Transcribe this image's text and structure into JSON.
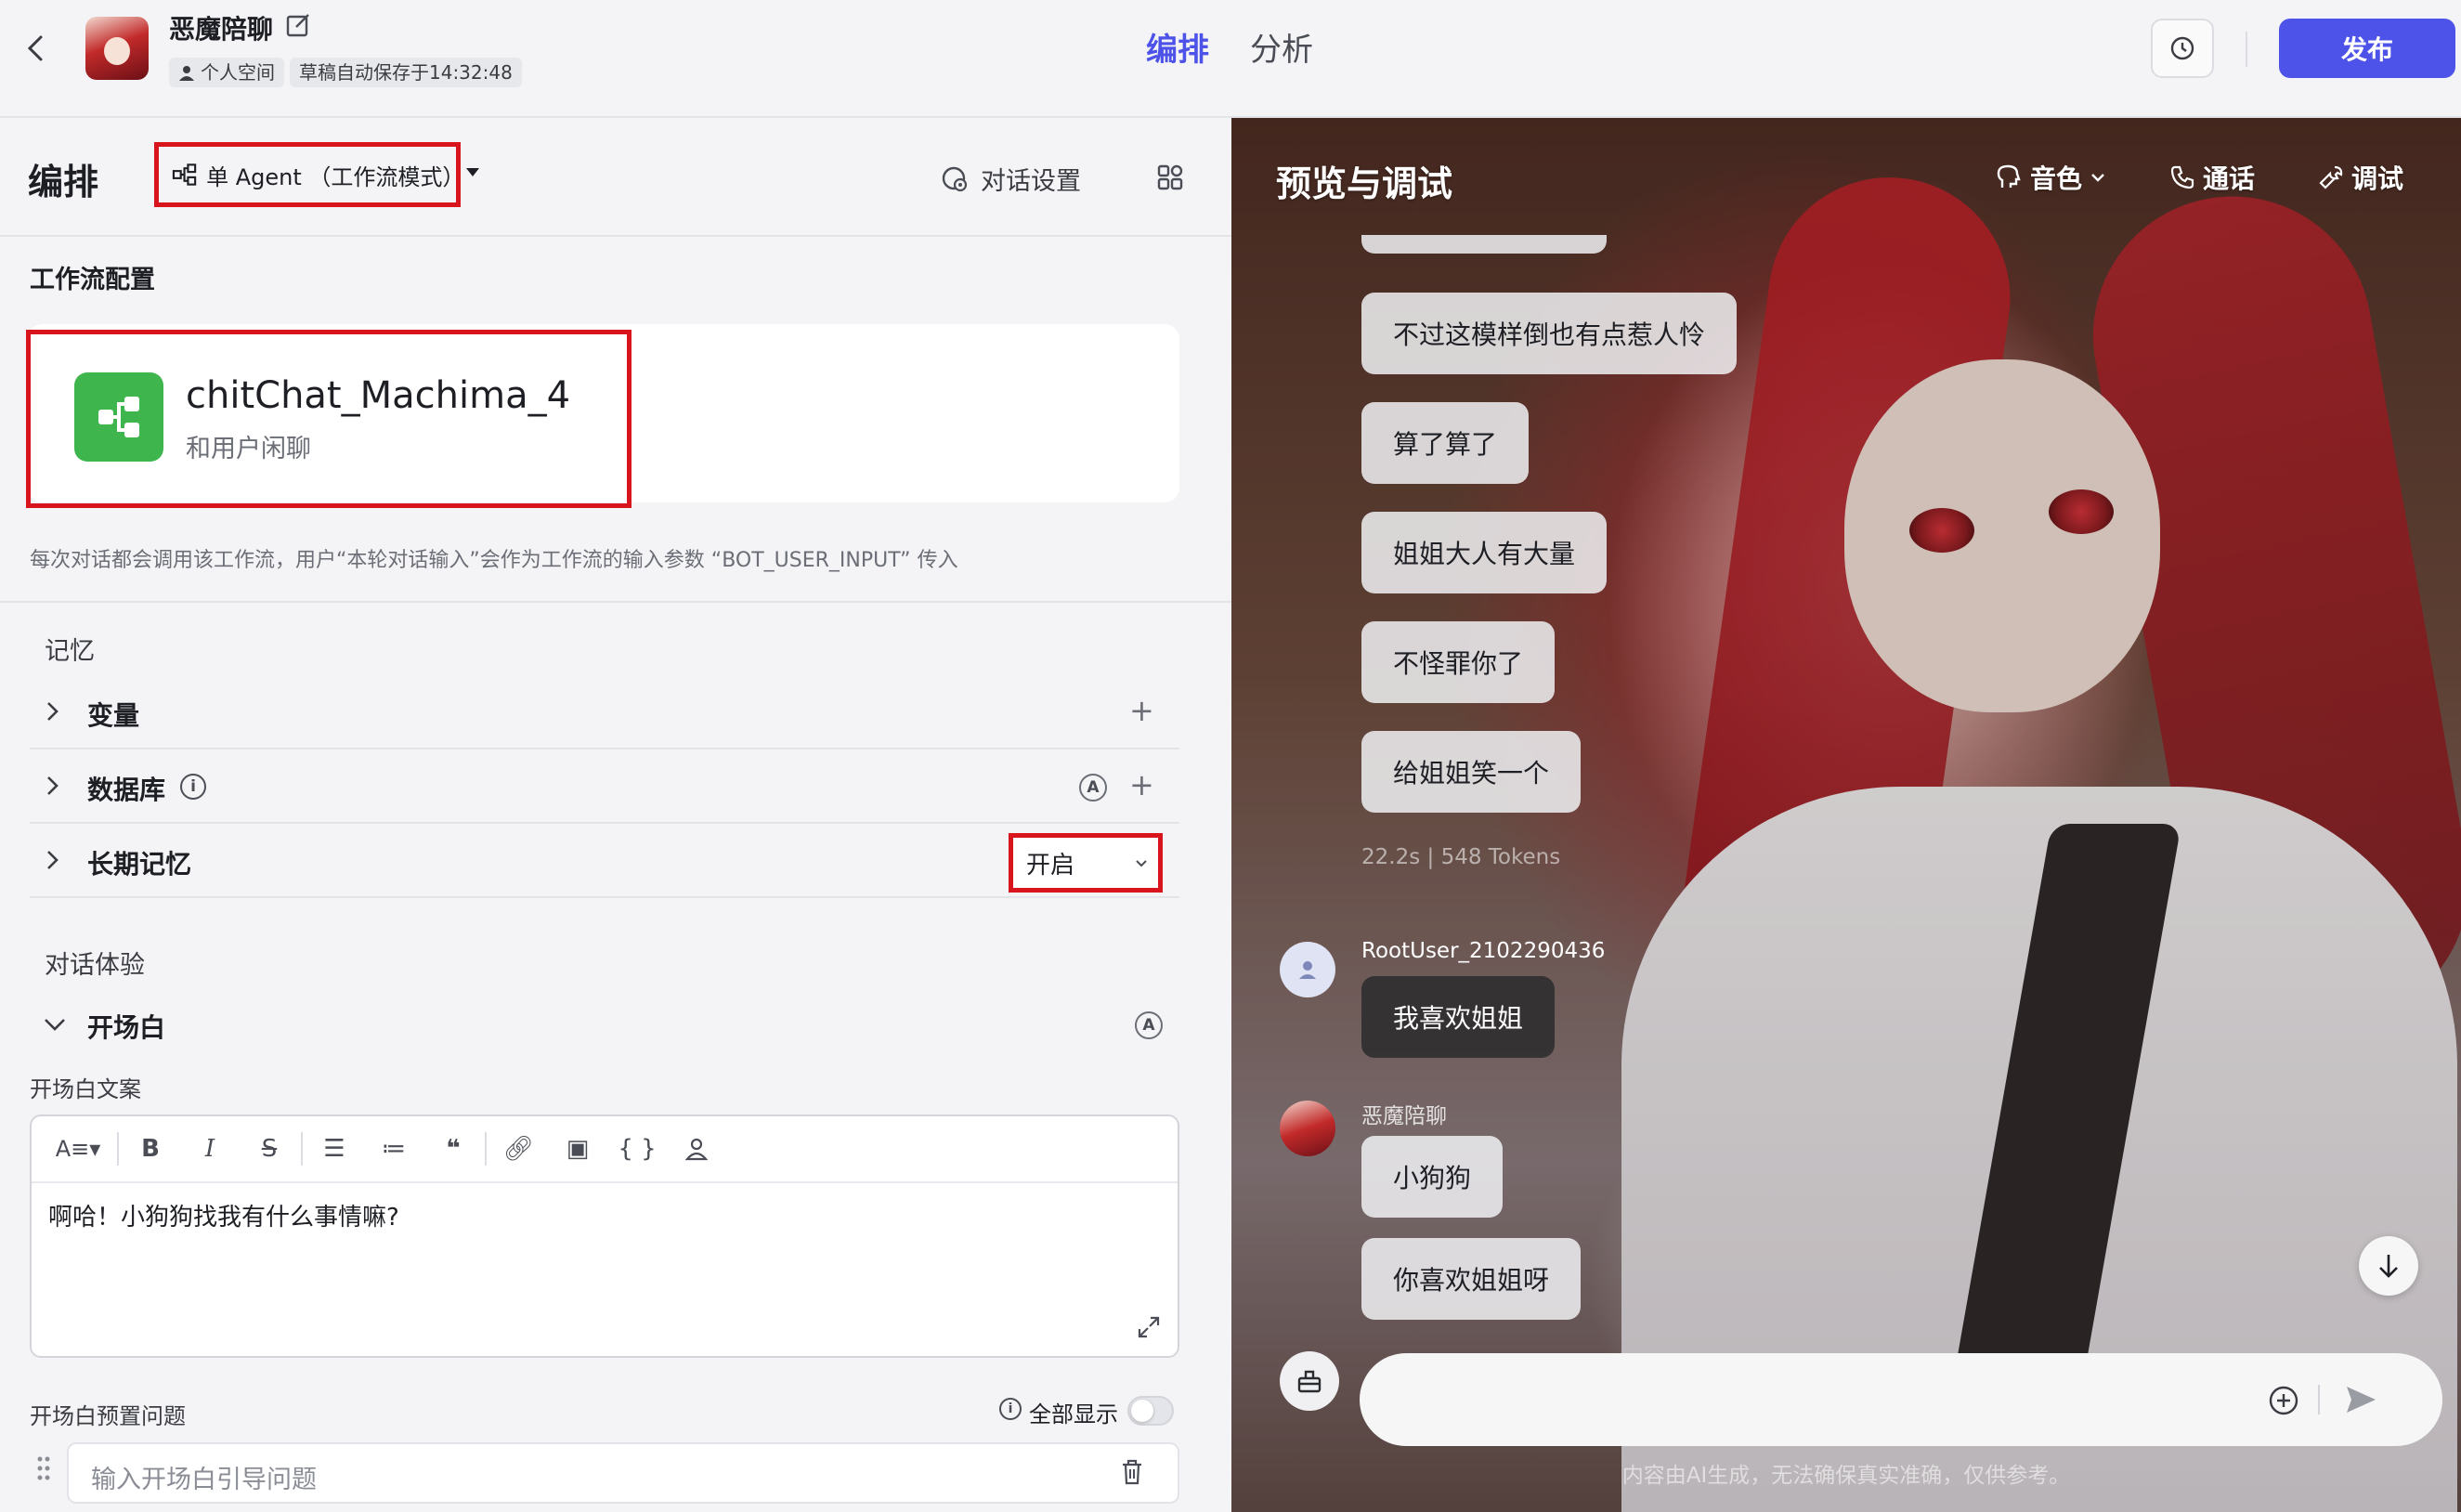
{
  "topbar": {
    "bot_name": "恶魔陪聊",
    "space_chip": "个人空间",
    "save_chip": "草稿自动保存于14:32:48",
    "tab_arrange": "编排",
    "tab_analyze": "分析",
    "publish": "发布"
  },
  "left": {
    "title": "编排",
    "mode": "单 Agent （工作流模式）",
    "dialog_settings": "对话设置",
    "workflow_section": "工作流配置",
    "workflow_name": "chitChat_Machima_4",
    "workflow_desc": "和用户闲聊",
    "workflow_hint": "每次对话都会调用该工作流，用户“本轮对话输入”会作为工作流的输入参数 “BOT_USER_INPUT” 传入",
    "memory_label": "记忆",
    "variables": "变量",
    "database": "数据库",
    "long_term_memory": "长期记忆",
    "ltm_value": "开启",
    "experience_label": "对话体验",
    "opening": "开场白",
    "opening_text_label": "开场白文案",
    "opening_text": "啊哈！小狗狗找我有什么事情嘛?",
    "preset_questions_label": "开场白预置问题",
    "show_all": "全部显示",
    "question_placeholder": "输入开场白引导问题"
  },
  "right": {
    "title": "预览与调试",
    "voice": "音色",
    "call": "通话",
    "debug": "调试",
    "messages": [
      "不过这模样倒也有点惹人怜",
      "算了算了",
      "姐姐大人有大量",
      "不怪罪你了",
      "给姐姐笑一个"
    ],
    "meta": "22.2s  |  548 Tokens",
    "user_name": "RootUser_2102290436",
    "user_message": "我喜欢姐姐",
    "bot_name": "恶魔陪聊",
    "bot_replies": [
      "小狗狗",
      "你喜欢姐姐呀"
    ],
    "disclaimer": "内容由AI生成，无法确保真实准确，仅供参考。"
  },
  "colors": {
    "accent": "#4d53e8",
    "highlight": "#d8141c",
    "workflow_icon": "#3eb54d"
  }
}
